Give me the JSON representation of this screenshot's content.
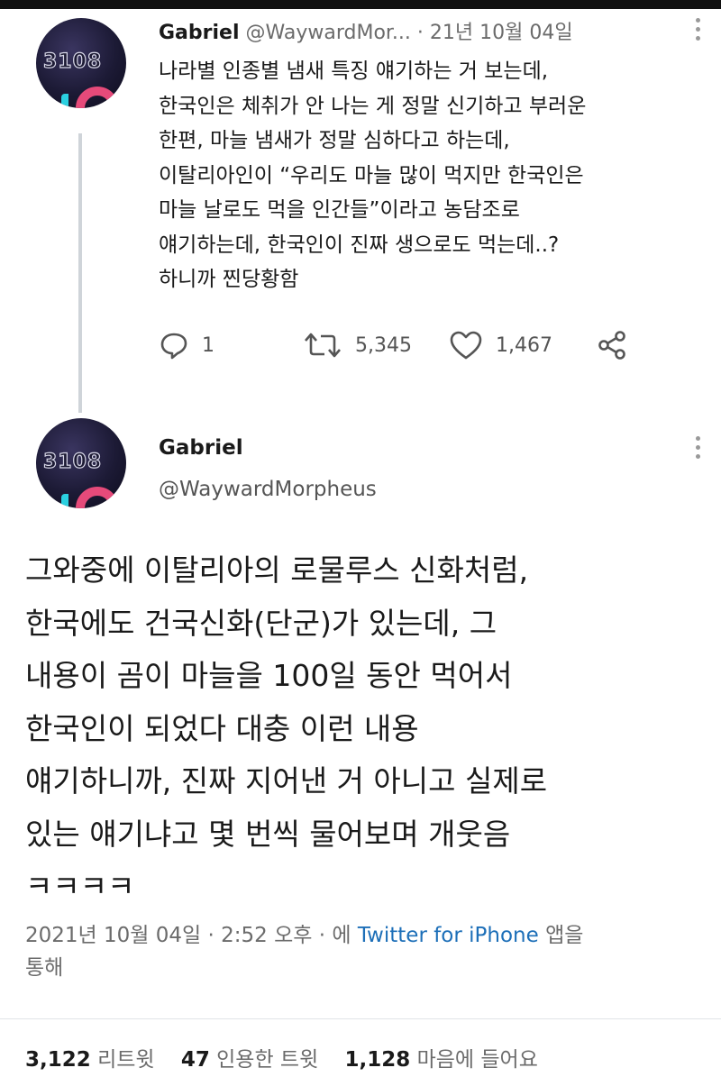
{
  "tweet1": {
    "avatar_text": "3108",
    "name": "Gabriel",
    "handle": "@WaywardMor...",
    "separator": "·",
    "date": "21년 10월 04일",
    "lines": [
      "나라별 인종별 냄새 특징 얘기하는 거 보는데,",
      "한국인은 체취가 안 나는 게 정말 신기하고 부러운",
      "한편, 마늘 냄새가 정말 심하다고 하는데,",
      "이탈리아인이 “우리도 마늘 많이 먹지만 한국인은",
      "마늘 날로도 먹을 인간들”이라고 농담조로",
      "얘기하는데, 한국인이 진짜 생으로도 먹는데..?",
      "하니까 찐당황함"
    ],
    "actions": {
      "reply_count": "1",
      "retweet_count": "5,345",
      "like_count": "1,467"
    }
  },
  "tweet2": {
    "avatar_text": "3108",
    "name": "Gabriel",
    "handle": "@WaywardMorpheus",
    "lines": [
      "그와중에 이탈리아의 로물루스 신화처럼,",
      "한국에도 건국신화(단군)가 있는데, 그",
      "내용이 곰이 마늘을 100일 동안 먹어서",
      "한국인이 되었다 대충 이런 내용",
      "얘기하니까, 진짜 지어낸 거 아니고 실제로",
      "있는 얘기냐고 몇 번씩 물어보며 개웃음",
      "ㅋㅋㅋㅋ"
    ],
    "meta": {
      "date": "2021년 10월 04일",
      "time": "2:52 오후",
      "via_prefix": "에",
      "source": "Twitter for iPhone",
      "via_suffix": "앱을",
      "line2": "통해"
    },
    "stats": {
      "retweets": "3,122",
      "retweets_label": "리트윗",
      "quotes": "47",
      "quotes_label": "인용한 트윗",
      "likes": "1,128",
      "likes_label": "마음에 들어요"
    }
  },
  "colors": {
    "text": "#1a1a1a",
    "muted": "#6b6b6b",
    "link": "#1d6fb8",
    "thread_line": "#cfd4d9"
  },
  "icons": [
    "reply-icon",
    "retweet-icon",
    "like-icon",
    "share-icon",
    "more-icon"
  ]
}
